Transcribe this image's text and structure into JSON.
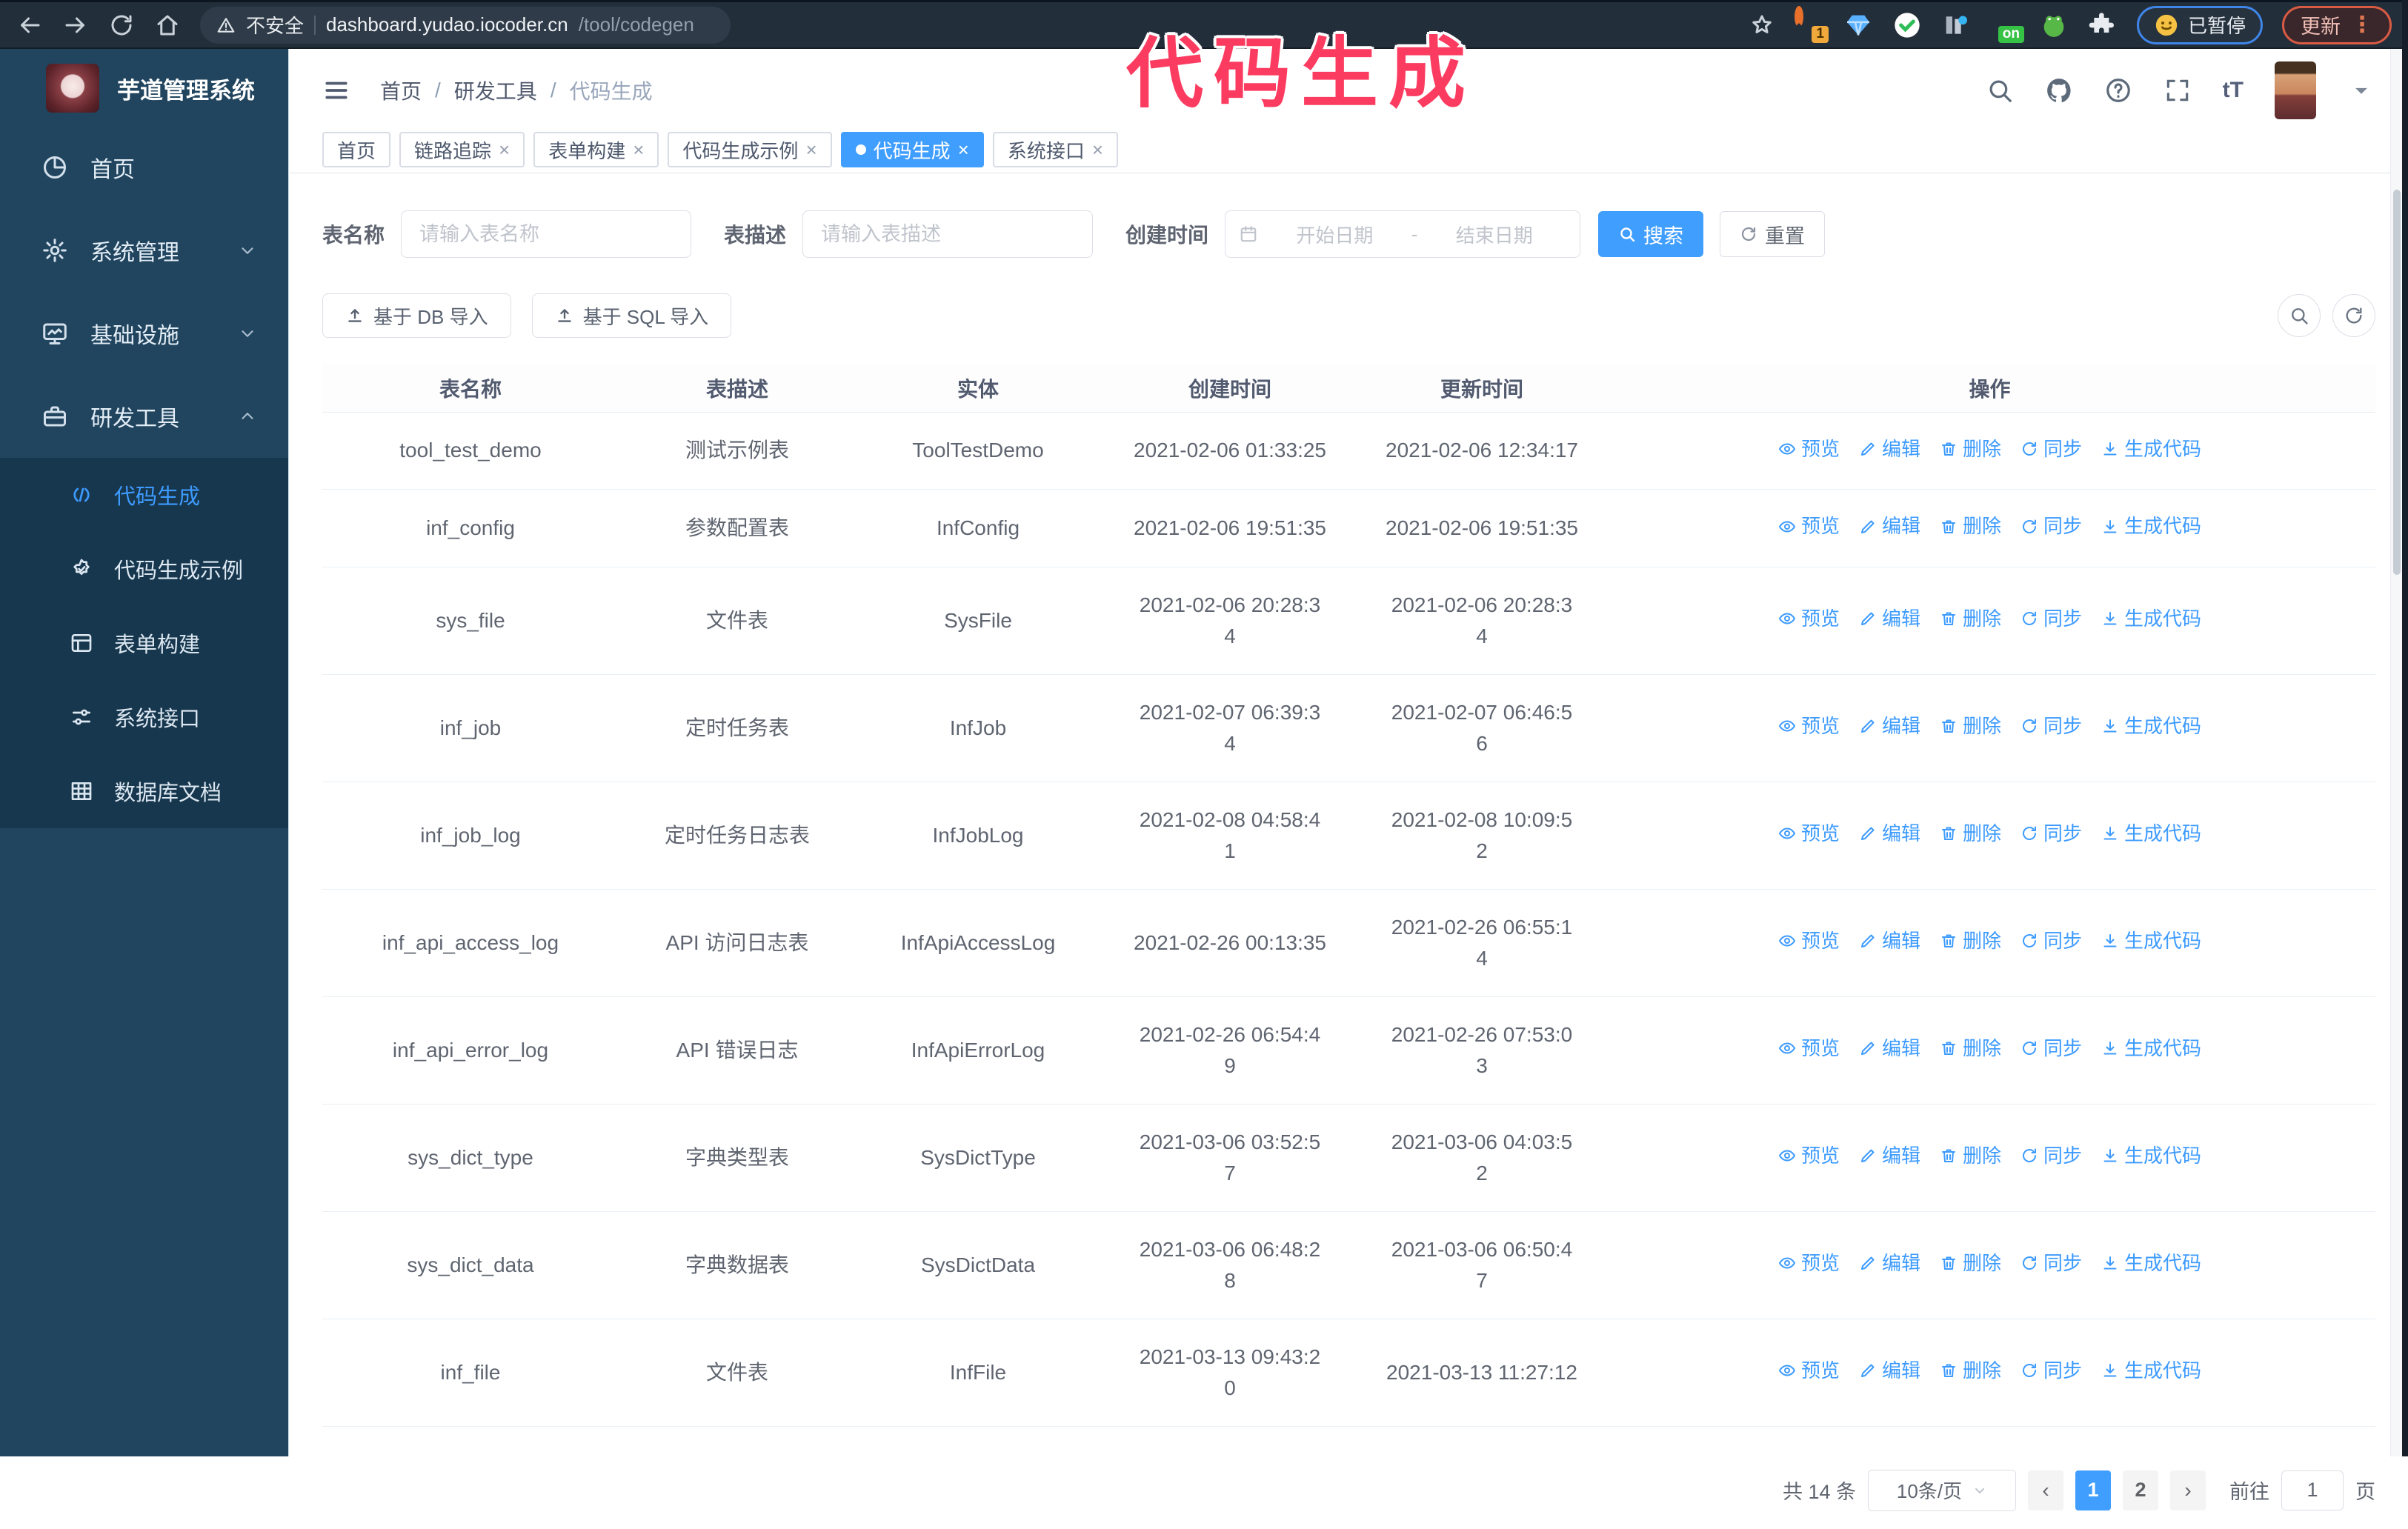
{
  "browser": {
    "security_label": "不安全",
    "url_host": "dashboard.yudao.iocoder.cn",
    "url_path": "/tool/codegen",
    "ext_badge_count": "1",
    "ext_on_badge": "on",
    "paused_badge": "已暂停",
    "update_button": "更新"
  },
  "annotation": {
    "text": "代码生成",
    "color": "#fb3c60"
  },
  "sidebar": {
    "title": "芋道管理系统",
    "items": [
      {
        "label": "首页",
        "icon": "pie-chart-icon"
      },
      {
        "label": "系统管理",
        "icon": "gear-icon",
        "chevron": "down"
      },
      {
        "label": "基础设施",
        "icon": "monitor-icon",
        "chevron": "down"
      },
      {
        "label": "研发工具",
        "icon": "briefcase-icon",
        "chevron": "up",
        "expanded": true
      }
    ],
    "subitems": [
      {
        "label": "代码生成",
        "icon": "code-icon",
        "active": true
      },
      {
        "label": "代码生成示例",
        "icon": "badge-check-icon"
      },
      {
        "label": "表单构建",
        "icon": "form-icon"
      },
      {
        "label": "系统接口",
        "icon": "sliders-icon"
      },
      {
        "label": "数据库文档",
        "icon": "table-grid-icon"
      }
    ]
  },
  "header": {
    "breadcrumb": [
      "首页",
      "研发工具",
      "代码生成"
    ],
    "breadcrumb_separator": "/"
  },
  "tabs": [
    {
      "label": "首页",
      "closable": false,
      "active": false
    },
    {
      "label": "链路追踪",
      "closable": true,
      "active": false
    },
    {
      "label": "表单构建",
      "closable": true,
      "active": false
    },
    {
      "label": "代码生成示例",
      "closable": true,
      "active": false
    },
    {
      "label": "代码生成",
      "closable": true,
      "active": true
    },
    {
      "label": "系统接口",
      "closable": true,
      "active": false
    }
  ],
  "filters": {
    "table_name_label": "表名称",
    "table_name_placeholder": "请输入表名称",
    "table_desc_label": "表描述",
    "table_desc_placeholder": "请输入表描述",
    "create_time_label": "创建时间",
    "date_start_placeholder": "开始日期",
    "date_separator": "-",
    "date_end_placeholder": "结束日期",
    "search_button": "搜索",
    "reset_button": "重置"
  },
  "toolbar": {
    "import_db_button": "基于 DB 导入",
    "import_sql_button": "基于 SQL 导入"
  },
  "table": {
    "columns": [
      "表名称",
      "表描述",
      "实体",
      "创建时间",
      "更新时间",
      "操作"
    ],
    "actions": [
      "预览",
      "编辑",
      "删除",
      "同步",
      "生成代码"
    ],
    "rows": [
      {
        "name": "tool_test_demo",
        "desc": "测试示例表",
        "entity": "ToolTestDemo",
        "created": "2021-02-06 01:33:25",
        "updated": "2021-02-06 12:34:17"
      },
      {
        "name": "inf_config",
        "desc": "参数配置表",
        "entity": "InfConfig",
        "created": "2021-02-06 19:51:35",
        "updated": "2021-02-06 19:51:35"
      },
      {
        "name": "sys_file",
        "desc": "文件表",
        "entity": "SysFile",
        "created": "2021-02-06 20:28:3\n4",
        "updated": "2021-02-06 20:28:3\n4"
      },
      {
        "name": "inf_job",
        "desc": "定时任务表",
        "entity": "InfJob",
        "created": "2021-02-07 06:39:3\n4",
        "updated": "2021-02-07 06:46:5\n6"
      },
      {
        "name": "inf_job_log",
        "desc": "定时任务日志表",
        "entity": "InfJobLog",
        "created": "2021-02-08 04:58:4\n1",
        "updated": "2021-02-08 10:09:5\n2"
      },
      {
        "name": "inf_api_access_log",
        "desc": "API 访问日志表",
        "entity": "InfApiAccessLog",
        "created": "2021-02-26 00:13:35",
        "updated": "2021-02-26 06:55:1\n4"
      },
      {
        "name": "inf_api_error_log",
        "desc": "API 错误日志",
        "entity": "InfApiErrorLog",
        "created": "2021-02-26 06:54:4\n9",
        "updated": "2021-02-26 07:53:0\n3"
      },
      {
        "name": "sys_dict_type",
        "desc": "字典类型表",
        "entity": "SysDictType",
        "created": "2021-03-06 03:52:5\n7",
        "updated": "2021-03-06 04:03:5\n2"
      },
      {
        "name": "sys_dict_data",
        "desc": "字典数据表",
        "entity": "SysDictData",
        "created": "2021-03-06 06:48:2\n8",
        "updated": "2021-03-06 06:50:4\n7"
      },
      {
        "name": "inf_file",
        "desc": "文件表",
        "entity": "InfFile",
        "created": "2021-03-13 09:43:2\n0",
        "updated": "2021-03-13 11:27:12"
      }
    ]
  },
  "pagination": {
    "total": "共 14 条",
    "page_size": "10条/页",
    "pages": [
      "1",
      "2"
    ],
    "active_page": "1",
    "goto_label": "前往",
    "goto_value": "1",
    "goto_suffix": "页"
  }
}
